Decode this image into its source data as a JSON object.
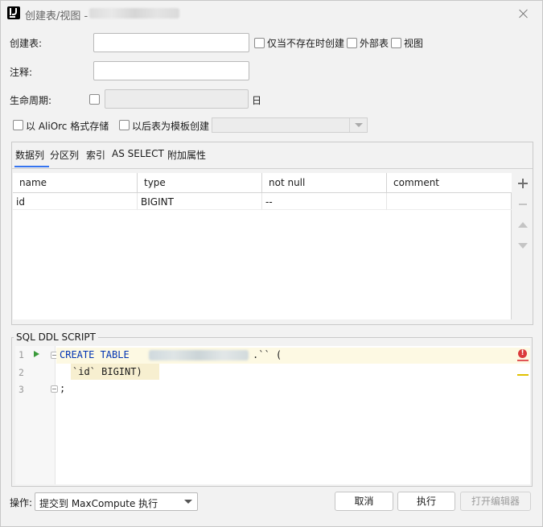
{
  "window": {
    "title": "创建表/视图 -"
  },
  "form": {
    "create_table_label": "创建表:",
    "create_table_value": "",
    "only_if_not_exists_label": "仅当不存在时创建",
    "external_table_label": "外部表",
    "view_label": "视图",
    "comment_label": "注释:",
    "comment_value": "",
    "lifecycle_label": "生命周期:",
    "lifecycle_value": "",
    "lifecycle_unit": "日",
    "aliorc_label": "以 AliOrc 格式存储",
    "template_label": "以后表为模板创建",
    "template_value": ""
  },
  "tabs": [
    {
      "label": "数据列",
      "active": true
    },
    {
      "label": "分区列",
      "active": false
    },
    {
      "label": "索引",
      "active": false
    },
    {
      "label": "AS SELECT",
      "active": false
    },
    {
      "label": "附加属性",
      "active": false
    }
  ],
  "columns_table": {
    "headers": [
      "name",
      "type",
      "not null",
      "comment"
    ],
    "rows": [
      [
        "id",
        "BIGINT",
        "--",
        ""
      ]
    ]
  },
  "sql": {
    "legend": "SQL DDL SCRIPT",
    "line_numbers": [
      "1",
      "2",
      "3"
    ],
    "line1_keyword": "CREATE TABLE",
    "line1_rest": ".`` (",
    "line2": "`id` BIGINT)",
    "line3": ";",
    "error_glyph": "!"
  },
  "footer": {
    "operation_label": "操作:",
    "operation_value": "提交到 MaxCompute 执行",
    "cancel_label": "取消",
    "execute_label": "执行",
    "open_editor_label": "打开编辑器"
  },
  "colors": {
    "accent": "#3574f0",
    "keyword": "#0033b3",
    "error": "#db3b3b",
    "run": "#3a9a3a"
  }
}
